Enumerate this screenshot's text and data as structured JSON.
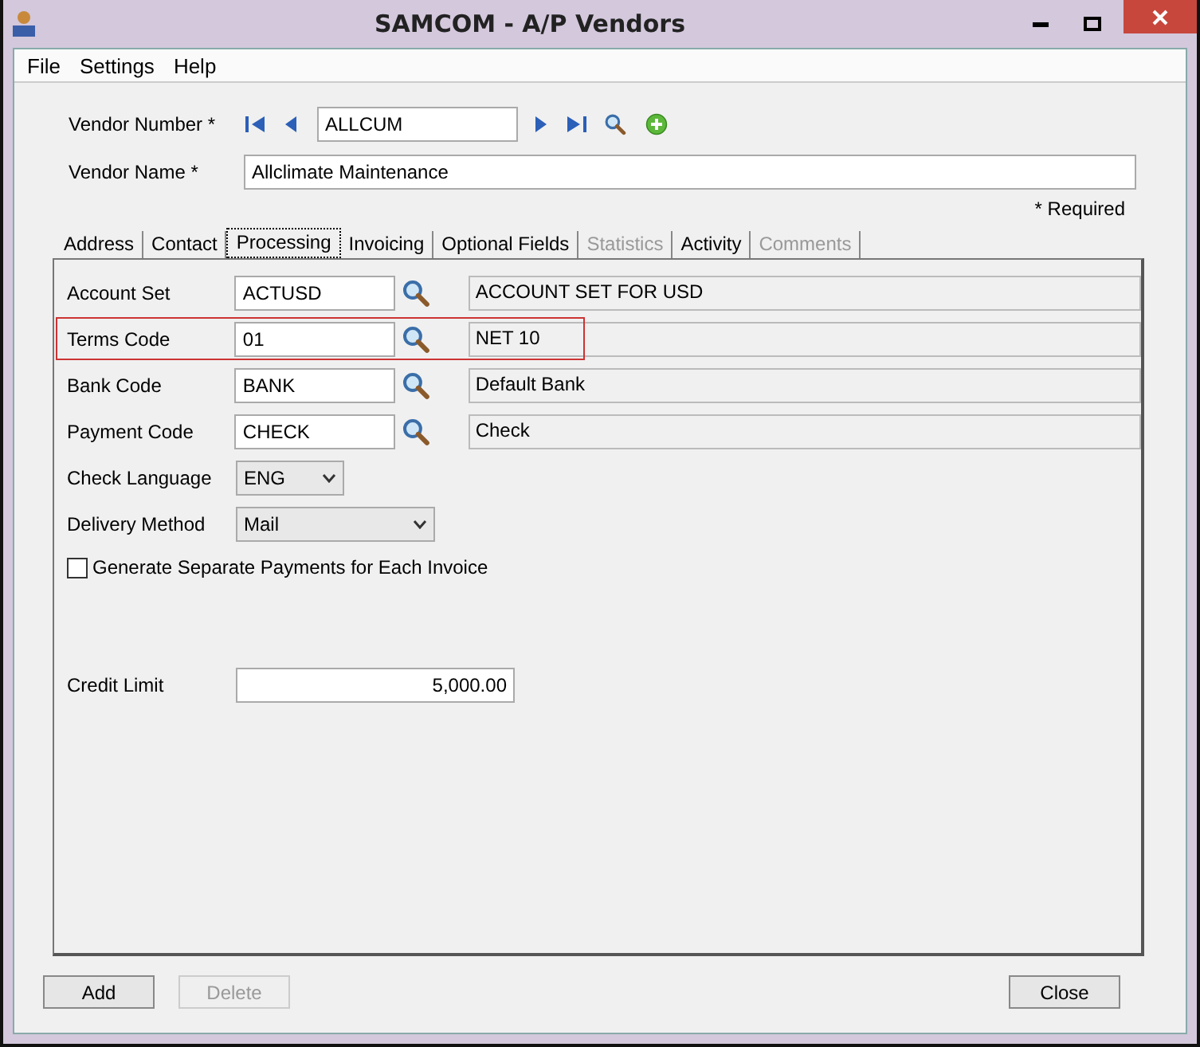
{
  "window": {
    "title": "SAMCOM - A/P Vendors"
  },
  "menu": [
    "File",
    "Settings",
    "Help"
  ],
  "vendor_number": {
    "label": "Vendor Number *",
    "value": "ALLCUM"
  },
  "vendor_name": {
    "label": "Vendor Name *",
    "value": "Allclimate Maintenance"
  },
  "required_note": "* Required",
  "tabs": [
    {
      "label": "Address",
      "selected": false,
      "disabled": false
    },
    {
      "label": "Contact",
      "selected": false,
      "disabled": false
    },
    {
      "label": "Processing",
      "selected": true,
      "disabled": false
    },
    {
      "label": "Invoicing",
      "selected": false,
      "disabled": false
    },
    {
      "label": "Optional Fields",
      "selected": false,
      "disabled": false
    },
    {
      "label": "Statistics",
      "selected": false,
      "disabled": true
    },
    {
      "label": "Activity",
      "selected": false,
      "disabled": false
    },
    {
      "label": "Comments",
      "selected": false,
      "disabled": true
    }
  ],
  "fields": [
    {
      "kind": "lookup",
      "label": "Account Set",
      "value": "ACTUSD",
      "description": "ACCOUNT SET FOR USD",
      "highlighted": false
    },
    {
      "kind": "lookup",
      "label": "Terms Code",
      "value": "01",
      "description": "NET 10",
      "highlighted": true
    },
    {
      "kind": "lookup",
      "label": "Bank Code",
      "value": "BANK",
      "description": "Default Bank",
      "highlighted": false
    },
    {
      "kind": "lookup",
      "label": "Payment Code",
      "value": "CHECK",
      "description": "Check",
      "highlighted": false
    },
    {
      "kind": "short-select",
      "label": "Check Language",
      "value": "ENG"
    },
    {
      "kind": "long-select",
      "label": "Delivery Method",
      "value": "Mail"
    },
    {
      "kind": "checkbox",
      "label": "Generate Separate Payments for Each Invoice",
      "checked": false
    },
    {
      "kind": "amount",
      "label": "Credit Limit",
      "value": "5,000.00"
    }
  ],
  "buttons": [
    {
      "label": "Add",
      "disabled": false
    },
    {
      "label": "Delete",
      "disabled": true
    },
    {
      "label": "Close",
      "disabled": false
    }
  ]
}
